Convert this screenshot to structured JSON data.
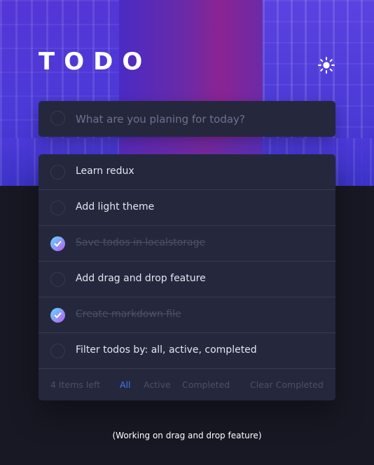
{
  "header": {
    "title": "TODO",
    "theme_icon": "sun-icon"
  },
  "new_todo": {
    "placeholder": "What are you planing for today?",
    "value": ""
  },
  "todos": [
    {
      "text": "Learn redux",
      "completed": false
    },
    {
      "text": "Add light theme",
      "completed": false
    },
    {
      "text": "Save todos in localstorage",
      "completed": true
    },
    {
      "text": "Add drag and drop feature",
      "completed": false
    },
    {
      "text": "Create markdown file",
      "completed": true
    },
    {
      "text": "Filter todos by: all, active, completed",
      "completed": false
    }
  ],
  "footer": {
    "items_left": "4 Items left",
    "filters": [
      "All",
      "Active",
      "Completed"
    ],
    "active_filter": "All",
    "clear_label": "Clear Completed"
  },
  "note": "(Working on drag and drop feature)",
  "colors": {
    "background": "#181824",
    "card": "#25273c",
    "accent": "#3a7cfd",
    "check_gradient_start": "#57ddff",
    "check_gradient_end": "#c058f3"
  }
}
